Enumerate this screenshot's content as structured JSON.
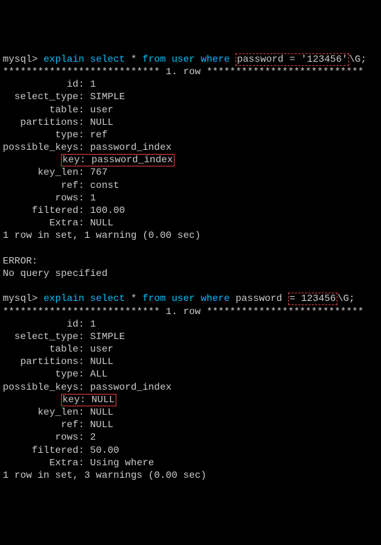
{
  "query1": {
    "prompt": "mysql>",
    "q_pre": "explain select",
    "q_star": "*",
    "q_from": "from",
    "q_table": "user",
    "q_where": "where",
    "q_cond_boxed": "password = '123456'",
    "q_after": "\\G;",
    "row_sep_left": "***************************",
    "row_label": "1. row",
    "row_sep_right": "***************************",
    "fields": [
      {
        "label": "id",
        "value": "1"
      },
      {
        "label": "select_type",
        "value": "SIMPLE"
      },
      {
        "label": "table",
        "value": "user"
      },
      {
        "label": "partitions",
        "value": "NULL"
      },
      {
        "label": "type",
        "value": "ref"
      },
      {
        "label": "possible_keys",
        "value": "password_index"
      },
      {
        "label": "key",
        "value": "password_index",
        "boxed": true
      },
      {
        "label": "key_len",
        "value": "767"
      },
      {
        "label": "ref",
        "value": "const"
      },
      {
        "label": "rows",
        "value": "1"
      },
      {
        "label": "filtered",
        "value": "100.00"
      },
      {
        "label": "Extra",
        "value": "NULL"
      }
    ],
    "footer": "1 row in set, 1 warning (0.00 sec)"
  },
  "error": {
    "line1": "ERROR:",
    "line2": "No query specified"
  },
  "query2": {
    "prompt": "mysql>",
    "q_pre": "explain select",
    "q_star": "*",
    "q_from": "from",
    "q_table": "user",
    "q_where": "where",
    "q_before_box": "password ",
    "q_cond_boxed": "= 123456",
    "q_after": "\\G;",
    "row_sep_left": "***************************",
    "row_label": "1. row",
    "row_sep_right": "***************************",
    "fields": [
      {
        "label": "id",
        "value": "1"
      },
      {
        "label": "select_type",
        "value": "SIMPLE"
      },
      {
        "label": "table",
        "value": "user"
      },
      {
        "label": "partitions",
        "value": "NULL"
      },
      {
        "label": "type",
        "value": "ALL"
      },
      {
        "label": "possible_keys",
        "value": "password_index"
      },
      {
        "label": "key",
        "value": "NULL",
        "boxed": true
      },
      {
        "label": "key_len",
        "value": "NULL"
      },
      {
        "label": "ref",
        "value": "NULL"
      },
      {
        "label": "rows",
        "value": "2"
      },
      {
        "label": "filtered",
        "value": "50.00"
      },
      {
        "label": "Extra",
        "value": "Using where"
      }
    ],
    "footer": "1 row in set, 3 warnings (0.00 sec)"
  }
}
